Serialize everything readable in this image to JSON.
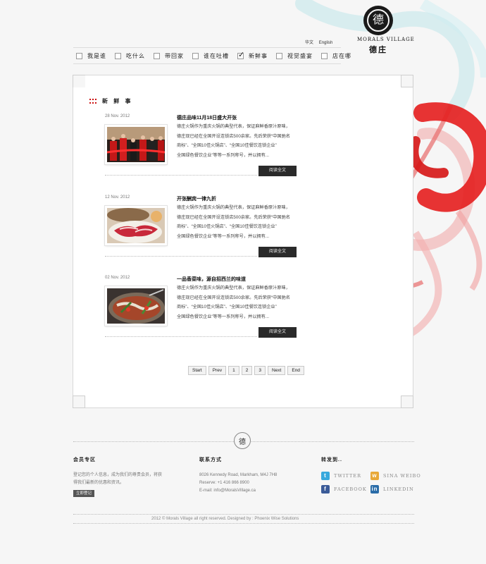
{
  "brand": {
    "name_en": "MORALS VILLAGE",
    "name_zh": "德庄"
  },
  "language": {
    "zh": "华文",
    "en": "English"
  },
  "nav": {
    "items": [
      {
        "label": "我是谁",
        "active": false
      },
      {
        "label": "吃什么",
        "active": false
      },
      {
        "label": "带回家",
        "active": false
      },
      {
        "label": "谁在吐槽",
        "active": false
      },
      {
        "label": "新鲜事",
        "active": true
      },
      {
        "label": "视觉盛宴",
        "active": false
      },
      {
        "label": "店在哪",
        "active": false
      }
    ]
  },
  "section": {
    "title": "新 鲜 事"
  },
  "articles": [
    {
      "date": "28 Nov. 2012",
      "title": "德庄品味11月18日盛大开张",
      "body": [
        "德庄火锅作为重庆火锅的典型代表，保证麻鲜香原汁原味，",
        "德庄现已经在全国开设连锁店500余家。先后荣获“中国驰名",
        "商标”、“全国10佳火锅店”、“全国10佳餐饮连锁企业”",
        "全国绿色餐饮企业”等等一系列称号，并以拥有..."
      ],
      "button": "阅读全文",
      "thumb": "ribbon-ceremony"
    },
    {
      "date": "12 Nov. 2012",
      "title": "开张酬宾一律九折",
      "body": [
        "德庄火锅作为重庆火锅的典型代表，保证麻鲜香原汁原味，",
        "德庄现已经在全国开设连锁店500余家。先后荣获“中国驰名",
        "商标”、“全国10佳火锅店”、“全国10佳餐饮连锁企业”",
        "全国绿色餐饮企业”等等一系列称号，并以拥有..."
      ],
      "button": "阅读全文",
      "thumb": "sliced-meat"
    },
    {
      "date": "02 Nov. 2012",
      "title": "一品香菜味，源自招西兰的味道",
      "body": [
        "德庄火锅作为重庆火锅的典型代表，保证麻鲜香原汁原味，",
        "德庄现已经在全国开设连锁店500余家。先后荣获“中国驰名",
        "商标”、“全国10佳火锅店”、“全国10佳餐饮连锁企业”",
        "全国绿色餐饮企业”等等一系列称号，并以拥有..."
      ],
      "button": "阅读全文",
      "thumb": "hotpot"
    }
  ],
  "pagination": [
    "Start",
    "Prev",
    "1",
    "2",
    "3",
    "Next",
    "End"
  ],
  "footer": {
    "member": {
      "title": "会员专区",
      "text": [
        "登记您的个人信息，成为我们的尊贵会员，将获",
        "得我们最新的优惠和资讯。"
      ],
      "button": "立即登记"
    },
    "contact": {
      "title": "联系方式",
      "address": "8026 Kennedy Road, Markham, M4J 7H8",
      "phone": "Reserve: +1 416 866 8900",
      "email": "E-mail: info@MoralsVillage.ca"
    },
    "share": {
      "title": "转发到..",
      "items": [
        {
          "label": "TWITTER",
          "icon": "twitter-icon",
          "color": "#39a9dd"
        },
        {
          "label": "SINA WEIBO",
          "icon": "weibo-icon",
          "color": "#e8a838"
        },
        {
          "label": "FACEBOOK",
          "icon": "facebook-icon",
          "color": "#3b5b98"
        },
        {
          "label": "LINKEDIN",
          "icon": "linkedin-icon",
          "color": "#2a6ca8"
        }
      ]
    },
    "copyright": "2012 © Morals Village all right reserved.   Designed by : Phoenix Wise Solutions"
  }
}
